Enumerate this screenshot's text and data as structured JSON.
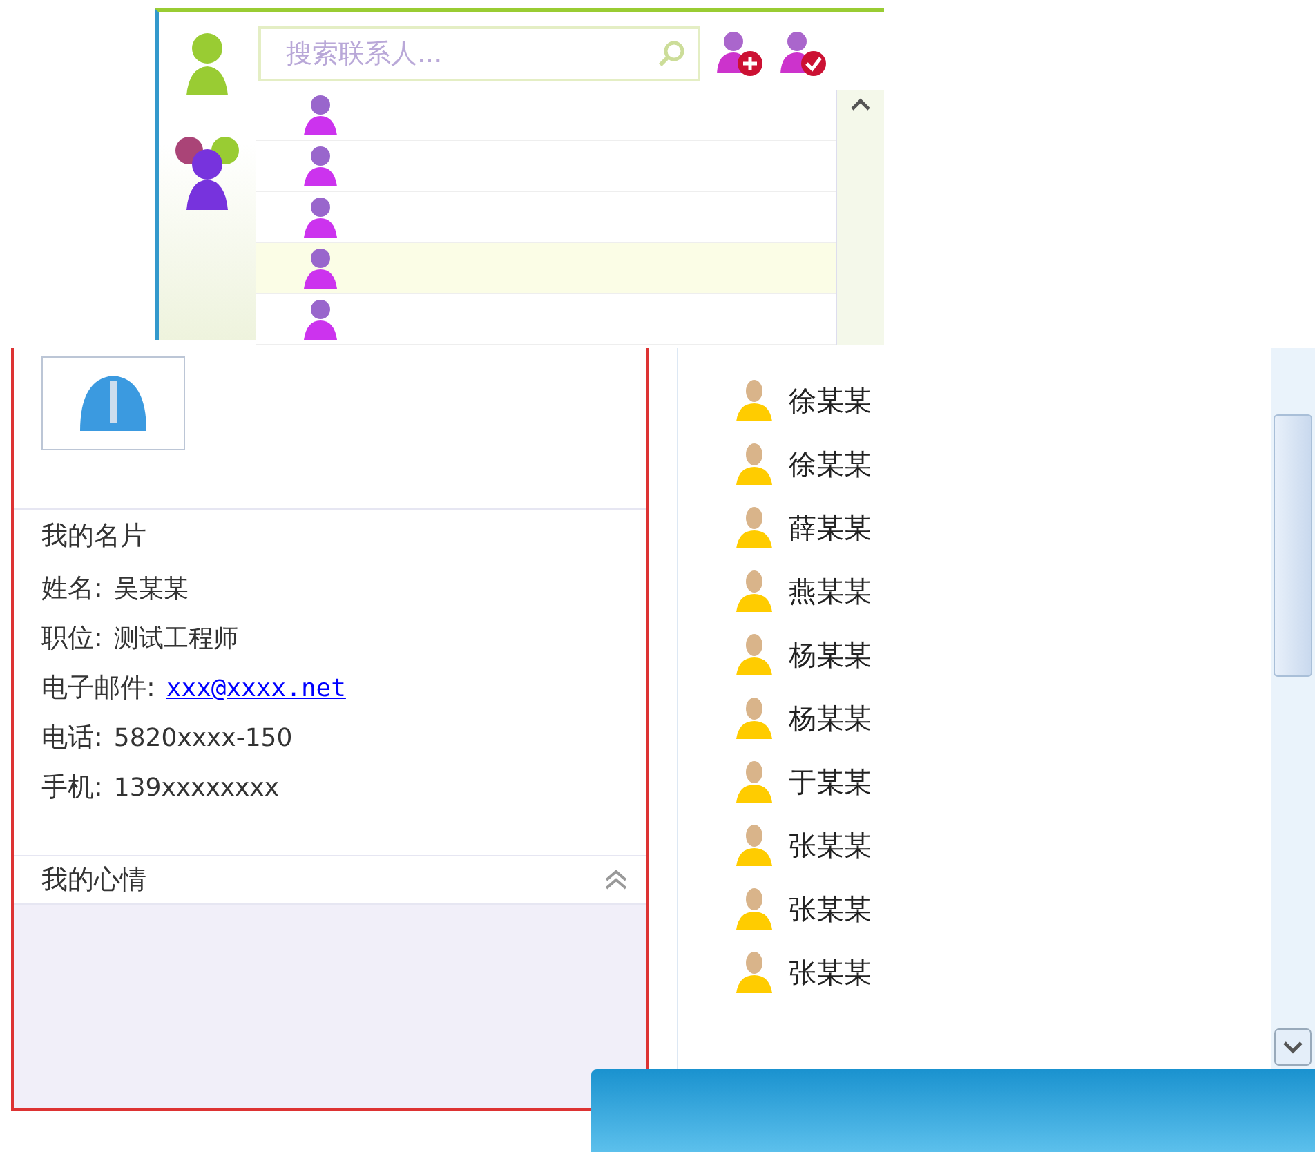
{
  "popup": {
    "search": {
      "placeholder": "搜索联系人..."
    },
    "results": [
      {
        "selected": false
      },
      {
        "selected": false
      },
      {
        "selected": false
      },
      {
        "selected": true
      },
      {
        "selected": false
      }
    ]
  },
  "card": {
    "title": "我的名片",
    "fields": [
      {
        "kind": "text",
        "label": "姓名:",
        "value": "吴某某"
      },
      {
        "kind": "text",
        "label": "职位:",
        "value": "测试工程师"
      },
      {
        "kind": "link",
        "label": "电子邮件:",
        "value": "xxx@xxxx.net"
      },
      {
        "kind": "text",
        "label": "电话:",
        "value": "5820xxxx-150"
      },
      {
        "kind": "text",
        "label": "手机:",
        "value": "139xxxxxxxx"
      }
    ]
  },
  "mood": {
    "title": "我的心情",
    "expanded": true
  },
  "contacts": [
    {
      "name": "徐某某"
    },
    {
      "name": "徐某某"
    },
    {
      "name": "薛某某"
    },
    {
      "name": "燕某某"
    },
    {
      "name": "杨某某"
    },
    {
      "name": "杨某某"
    },
    {
      "name": "于某某"
    },
    {
      "name": "张某某"
    },
    {
      "name": "张某某"
    },
    {
      "name": "张某某"
    }
  ]
}
